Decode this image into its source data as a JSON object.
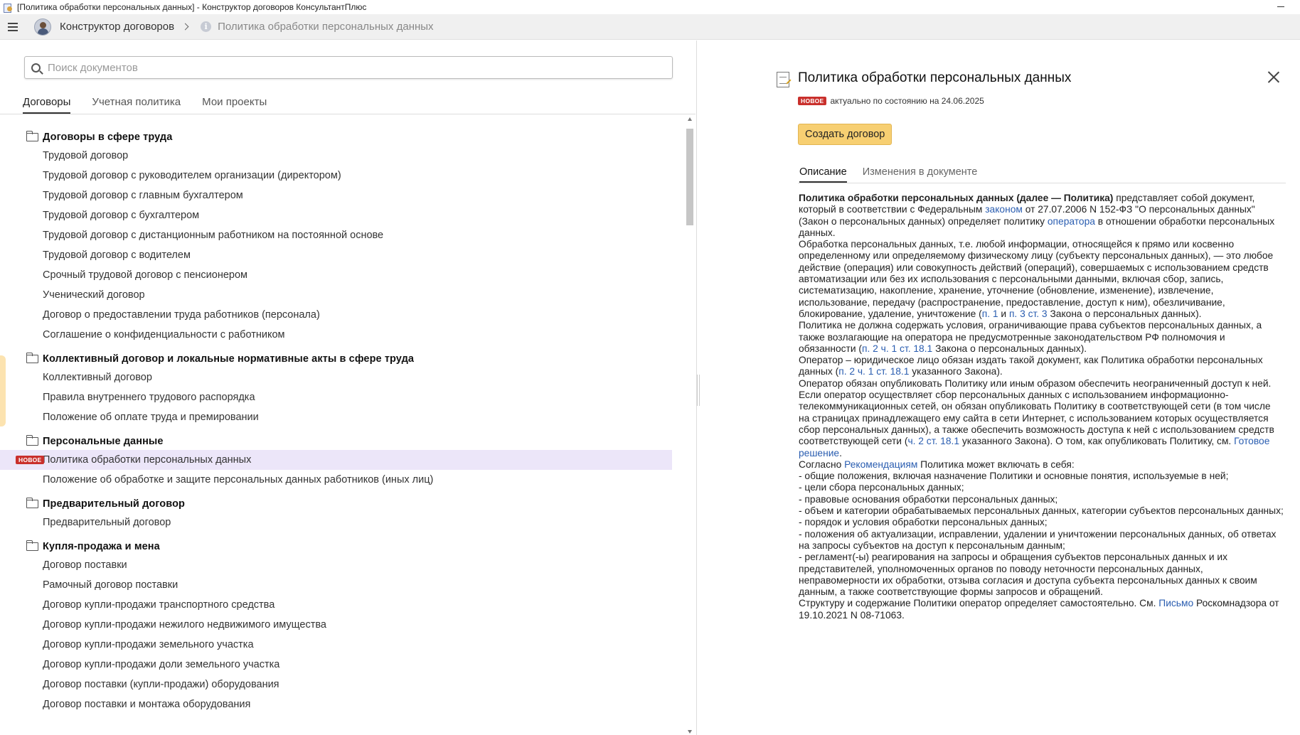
{
  "window": {
    "title": "[Политика обработки персональных данных] - Конструктор договоров КонсультантПлюс"
  },
  "nav": {
    "root": "Конструктор договоров",
    "current": "Политика обработки персональных данных"
  },
  "search": {
    "placeholder": "Поиск документов",
    "value": ""
  },
  "tabs": [
    "Договоры",
    "Учетная политика",
    "Мои проекты"
  ],
  "badge_new": "НОВОЕ",
  "tree": [
    {
      "title": "Договоры в сфере труда",
      "items": [
        "Трудовой договор",
        "Трудовой договор с руководителем организации (директором)",
        "Трудовой договор с главным бухгалтером",
        "Трудовой договор с бухгалтером",
        "Трудовой договор с дистанционным работником на постоянной основе",
        "Трудовой договор с водителем",
        "Срочный трудовой договор с пенсионером",
        "Ученический договор",
        "Договор о предоставлении труда работников (персонала)",
        "Соглашение о конфиденциальности с работником"
      ]
    },
    {
      "title": "Коллективный договор и локальные нормативные акты в сфере труда",
      "items": [
        "Коллективный договор",
        "Правила внутреннего трудового распорядка",
        "Положение об оплате труда и премировании"
      ]
    },
    {
      "title": "Персональные данные",
      "items": [
        "Политика обработки персональных данных",
        "Положение об обработке и защите персональных данных работников (иных лиц)"
      ]
    },
    {
      "title": "Предварительный договор",
      "items": [
        "Предварительный договор"
      ]
    },
    {
      "title": "Купля-продажа и мена",
      "items": [
        "Договор поставки",
        "Рамочный договор поставки",
        "Договор купли-продажи транспортного средства",
        "Договор купли-продажи нежилого недвижимого имущества",
        "Договор купли-продажи земельного участка",
        "Договор купли-продажи доли земельного участка",
        "Договор поставки (купли-продажи) оборудования",
        "Договор поставки и монтажа оборудования"
      ]
    }
  ],
  "doc": {
    "title": "Политика обработки персональных данных",
    "status": "актуально по состоянию на 24.06.2025",
    "create_button": "Создать договор",
    "tabs": [
      "Описание",
      "Изменения в документе"
    ],
    "paragraphs": [
      [
        {
          "b": "Политика обработки персональных данных (далее — Политика)"
        },
        {
          "t": " представляет собой документ, который в соответствии с Федеральным "
        },
        {
          "a": "законом"
        },
        {
          "t": " от 27.07.2006 N 152-ФЗ \"О персональных данных\" (Закон о персональных данных) определяет политику "
        },
        {
          "a": "оператора"
        },
        {
          "t": " в отношении обработки персональных данных."
        }
      ],
      [
        {
          "t": "Обработка персональных данных, т.е. любой информации, относящейся к прямо или косвенно определенному или определяемому физическому лицу (субъекту персональных данных), — это любое действие (операция) или совокупность действий (операций), совершаемых с использованием средств автоматизации или без их использования с персональными данными, включая сбор, запись, систематизацию, накопление, хранение, уточнение (обновление, изменение), извлечение, использование, передачу (распространение, предоставление, доступ к ним), обезличивание, блокирование, удаление, уничтожение ("
        },
        {
          "a": "п. 1"
        },
        {
          "t": " и "
        },
        {
          "a": "п. 3 ст. 3"
        },
        {
          "t": " Закона о персональных данных)."
        }
      ],
      [
        {
          "t": "Политика не должна содержать условия, ограничивающие права субъектов персональных данных, а также возлагающие на оператора не предусмотренные законодательством РФ полномочия и обязанности ("
        },
        {
          "a": "п. 2 ч. 1 ст. 18.1"
        },
        {
          "t": " Закона о персональных данных)."
        }
      ],
      [
        {
          "t": "Оператор – юридическое лицо обязан издать такой документ, как Политика обработки персональных данных ("
        },
        {
          "a": "п. 2 ч. 1 ст. 18.1"
        },
        {
          "t": " указанного Закона)."
        }
      ],
      [
        {
          "t": "Оператор обязан опубликовать Политику или иным образом обеспечить неограниченный доступ к ней. Если оператор осуществляет сбор персональных данных с использованием информационно-телекоммуникационных сетей, он обязан опубликовать Политику в соответствующей сети (в том числе на страницах принадлежащего ему сайта в сети Интернет, с использованием которых осуществляется сбор персональных данных), а также обеспечить возможность доступа к ней с использованием средств соответствующей сети ("
        },
        {
          "a": "ч. 2 ст. 18.1"
        },
        {
          "t": " указанного Закона). О том, как опубликовать Политику, см. "
        },
        {
          "a": "Готовое решение"
        },
        {
          "t": "."
        }
      ],
      [
        {
          "t": "Согласно "
        },
        {
          "a": "Рекомендациям"
        },
        {
          "t": " Политика может включать в себя:"
        }
      ],
      [
        {
          "t": "- общие положения, включая назначение Политики и основные понятия, используемые в ней;"
        }
      ],
      [
        {
          "t": "- цели сбора персональных данных;"
        }
      ],
      [
        {
          "t": "- правовые основания обработки персональных данных;"
        }
      ],
      [
        {
          "t": "- объем и категории обрабатываемых персональных данных, категории субъектов персональных данных;"
        }
      ],
      [
        {
          "t": "- порядок и условия обработки персональных данных;"
        }
      ],
      [
        {
          "t": "- положения об актуализации, исправлении, удалении и уничтожении персональных данных, об ответах на запросы субъектов на доступ к персональным данным;"
        }
      ],
      [
        {
          "t": "- регламент(-ы) реагирования на запросы и обращения субъектов персональных данных и их представителей, уполномоченных органов по поводу неточности персональных данных, неправомерности их обработки, отзыва согласия и доступа субъекта персональных данных к своим данным, а также соответствующие формы запросов и обращений."
        }
      ],
      [
        {
          "t": "Структуру и содержание Политики оператор определяет самостоятельно. См. "
        },
        {
          "a": "Письмо"
        },
        {
          "t": " Роскомнадзора от 19.10.2021 N 08-71063."
        }
      ]
    ]
  },
  "colors": {
    "accent_button": "#f7cf72",
    "selected_row": "#ece6f9",
    "badge": "#c9302c",
    "link": "#2a5db0"
  }
}
